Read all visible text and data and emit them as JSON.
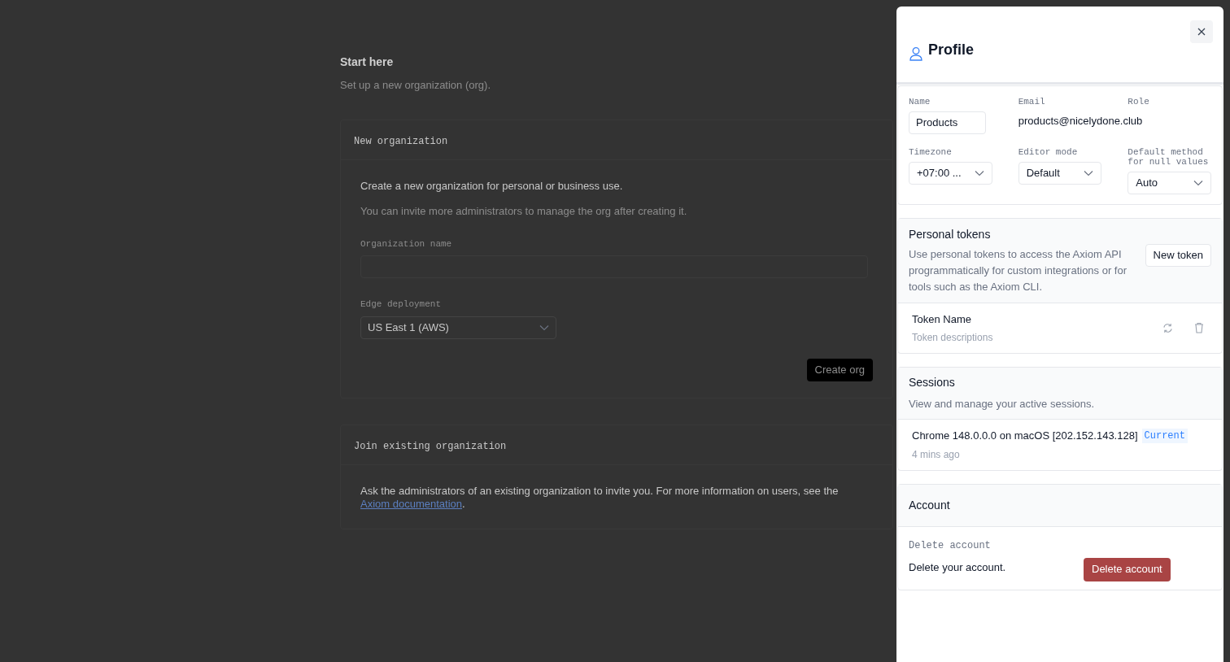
{
  "page": {
    "title": "Start here",
    "subtitle": "Set up a new organization (org).",
    "new_org": {
      "heading": "New organization",
      "lead": "Create a new organization for personal or business use.",
      "hint": "You can invite more administrators to manage the org after creating it.",
      "name_label": "Organization name",
      "deployment_label": "Edge deployment",
      "deployment_value": "US East 1 (AWS)",
      "button": "Create org"
    },
    "join_org": {
      "heading": "Join existing organization",
      "text": "Ask the administrators of an existing organization to invite you. For more information on users, see the",
      "link": "Axiom documentation",
      "after": "."
    }
  },
  "profile": {
    "title": "Profile",
    "fields": [
      {
        "kind": "input",
        "label": "Name",
        "value": "Products"
      },
      {
        "kind": "text",
        "label": "Email",
        "value": "products@nicelydone.club"
      },
      {
        "kind": "text",
        "label": "Role"
      },
      {
        "kind": "select",
        "label": "Timezone",
        "value": "+07:00 ..."
      },
      {
        "kind": "select",
        "label": "Editor mode",
        "value": "Default"
      },
      {
        "kind": "select",
        "label": "Default method for null values",
        "value": "Auto"
      }
    ],
    "tokens": {
      "title": "Personal tokens",
      "description": "Use personal tokens to access the Axiom API programmatically for custom integrations or for tools such as the Axiom CLI.",
      "button": "New token",
      "items": [
        {
          "name": "Token Name",
          "description": "Token descriptions"
        }
      ]
    },
    "sessions": {
      "title": "Sessions",
      "description": "View and manage your active sessions.",
      "items": [
        {
          "name": "Chrome 148.0.0.0 on macOS [202.152.143.128]",
          "badge": "Current",
          "time": "4 mins ago"
        }
      ]
    },
    "account": {
      "title": "Account",
      "label": "Delete account",
      "text": "Delete your account.",
      "button": "Delete account"
    }
  }
}
